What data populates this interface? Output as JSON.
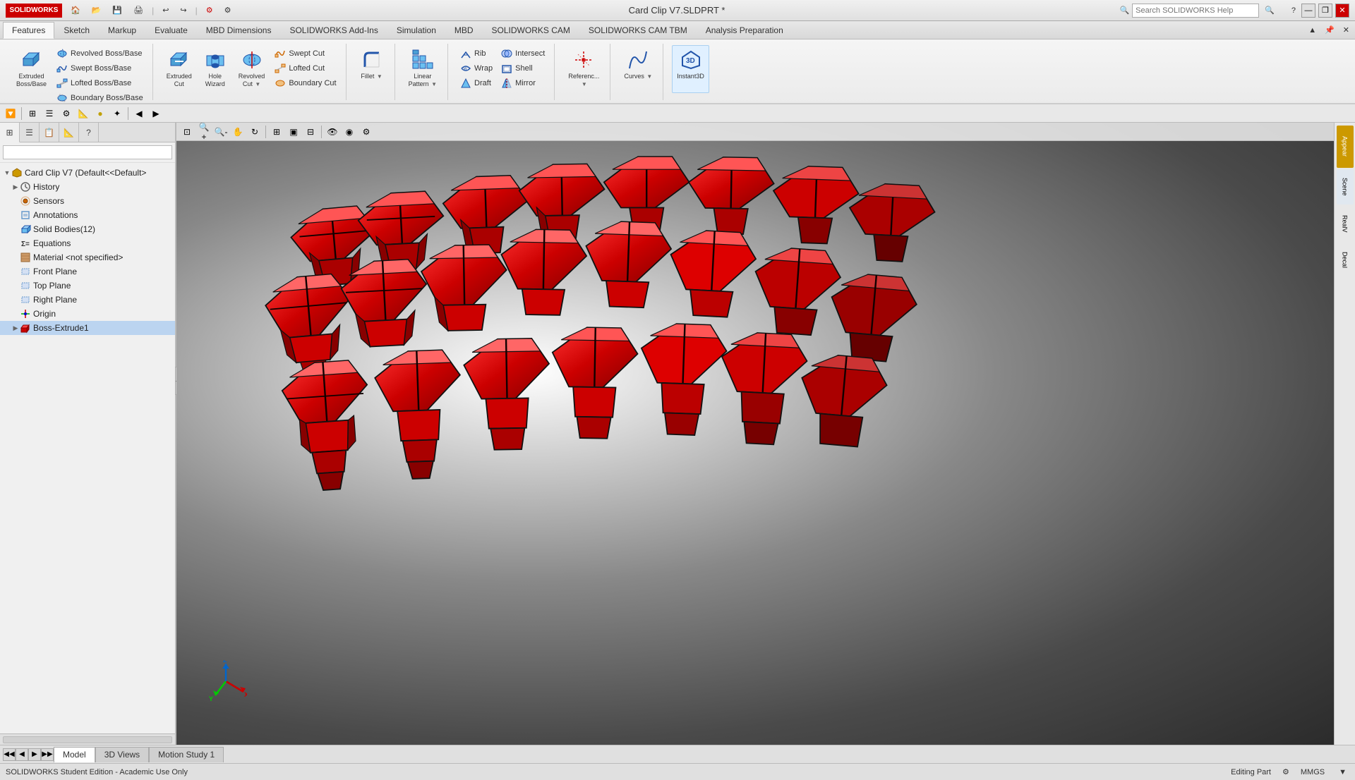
{
  "titlebar": {
    "logo": "SOLIDWORKS",
    "title": "Card Clip V7.SLDPRT *",
    "search_placeholder": "Search SOLIDWORKS Help",
    "buttons": {
      "minimize": "—",
      "restore": "❐",
      "close": "✕"
    }
  },
  "ribbon": {
    "tabs": [
      "Features",
      "Sketch",
      "Markup",
      "Evaluate",
      "MBD Dimensions",
      "SOLIDWORKS Add-Ins",
      "Simulation",
      "MBD",
      "SOLIDWORKS CAM",
      "SOLIDWORKS CAM TBM",
      "Analysis Preparation"
    ],
    "active_tab": "Features",
    "groups": {
      "extrude_boss": {
        "label": "Extruded Boss/Base",
        "btn_top": "Extruded Boss/Base",
        "btn_swept": "Swept Boss/Base",
        "btn_lofted": "Lofted Boss/Base",
        "btn_boundary": "Boundary Boss/Base"
      },
      "revolved": {
        "label": "Revolved Boss/Base",
        "btn": "Revolved Boss/Base",
        "dropdown": [
          "Swept Cut",
          "Lofted Cut",
          "Boundary Cut"
        ]
      },
      "cut": {
        "btn_extruded_cut": "Extruded Cut",
        "btn_hole": "Hole Wizard",
        "btn_revolved_cut": "Revolved Cut",
        "btn_swept_cut": "Swept Cut",
        "btn_lofted_cut": "Lofted Cut",
        "btn_boundary_cut": "Boundary Cut"
      },
      "fillet": {
        "btn": "Fillet",
        "dropdown": []
      },
      "linear_pattern": {
        "btn": "Linear Pattern",
        "dropdown": []
      },
      "rib_wrap": {
        "btn_rib": "Rib",
        "btn_wrap": "Wrap",
        "btn_draft": "Draft",
        "btn_intersect": "Intersect",
        "btn_shell": "Shell",
        "btn_mirror": "Mirror"
      },
      "reference": {
        "btn": "Reference..."
      },
      "curves": {
        "btn": "Curves"
      },
      "instant3d": {
        "btn": "Instant3D"
      }
    }
  },
  "left_panel": {
    "tabs": [
      "⊞",
      "☰",
      "📋",
      "📐",
      "?"
    ],
    "search_placeholder": "",
    "tree": {
      "root": "Card Clip V7  (Default<<Default>",
      "items": [
        {
          "label": "History",
          "icon": "clock",
          "expandable": true,
          "level": 1
        },
        {
          "label": "Sensors",
          "icon": "sensor",
          "expandable": false,
          "level": 1
        },
        {
          "label": "Annotations",
          "icon": "annotation",
          "expandable": false,
          "level": 1
        },
        {
          "label": "Solid Bodies(12)",
          "icon": "solidbodies",
          "expandable": false,
          "level": 1
        },
        {
          "label": "Equations",
          "icon": "equation",
          "expandable": false,
          "level": 1
        },
        {
          "label": "Material <not specified>",
          "icon": "material",
          "expandable": false,
          "level": 1
        },
        {
          "label": "Front Plane",
          "icon": "plane",
          "expandable": false,
          "level": 1
        },
        {
          "label": "Top Plane",
          "icon": "plane",
          "expandable": false,
          "level": 1
        },
        {
          "label": "Right Plane",
          "icon": "plane",
          "expandable": false,
          "level": 1
        },
        {
          "label": "Origin",
          "icon": "origin",
          "expandable": false,
          "level": 1
        },
        {
          "label": "Boss-Extrude1",
          "icon": "extrude",
          "expandable": true,
          "level": 1,
          "selected": true
        }
      ]
    }
  },
  "viewport_toolbar": {
    "buttons": [
      "zoom-fit",
      "zoom-in",
      "zoom-out",
      "pan",
      "rotate",
      "view-orient",
      "display-style",
      "section-view",
      "hide-show"
    ]
  },
  "status_bar": {
    "left": "SOLIDWORKS Student Edition - Academic Use Only",
    "editing": "Editing Part",
    "units": "MMGS",
    "arrow": "▼"
  },
  "bottom_tabs": {
    "nav_prev_prev": "◀◀",
    "nav_prev": "◀",
    "nav_next": "▶",
    "nav_next_next": "▶▶",
    "tabs": [
      "Model",
      "3D Views",
      "Motion Study 1"
    ],
    "active": "Model"
  }
}
